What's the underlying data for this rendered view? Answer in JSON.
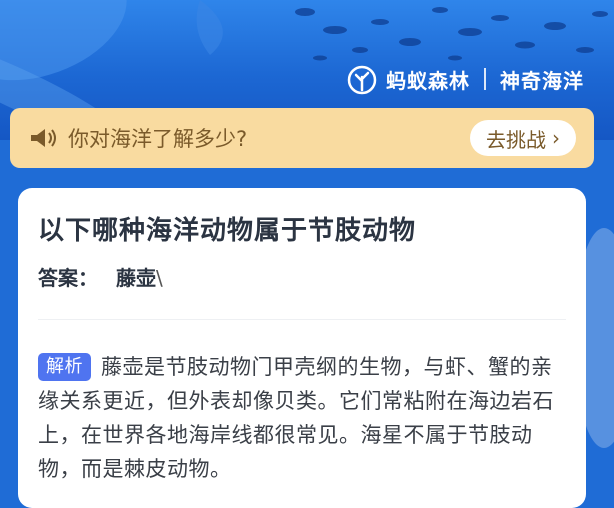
{
  "brand": {
    "name": "蚂蚁森林",
    "sub": "神奇海洋"
  },
  "notice": {
    "text": "你对海洋了解多少?",
    "button": "去挑战",
    "chevron": "›"
  },
  "card": {
    "question": "以下哪种海洋动物属于节肢动物",
    "answer_label": "答案：",
    "answer_value": "藤壶",
    "answer_cursor": "\\",
    "explain_tag": "解析",
    "explain_text": "藤壶是节肢动物门甲壳纲的生物，与虾、蟹的亲缘关系更近，但外表却像贝类。它们常粘附在海边岩石上，在世界各地海岸线都很常见。海星不属于节肢动物，而是棘皮动物。"
  },
  "icons": {
    "logo": "ant-forest-logo-icon",
    "speaker": "speaker-icon",
    "chevron": "chevron-right-icon"
  },
  "colors": {
    "hero": "#1f6cd6",
    "notice_bg": "#f9dba0",
    "notice_text": "#7a5a2a",
    "tag_bg": "#4f74f0"
  }
}
